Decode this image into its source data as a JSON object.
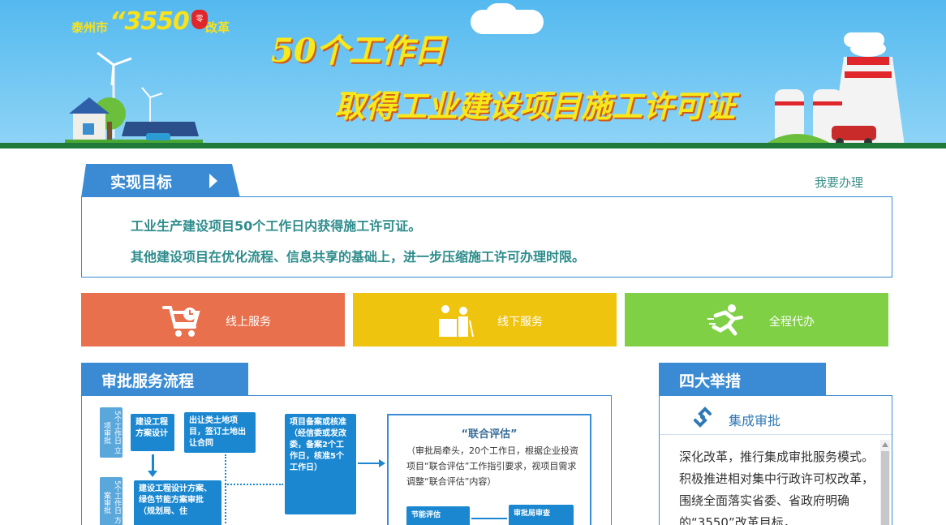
{
  "banner": {
    "logo_city": "泰州市",
    "logo_number": "“3550”",
    "logo_suffix": "改革",
    "logo_seal": "零",
    "headline_1": "50个工作日",
    "headline_2": "取得工业建设项目施工许可证"
  },
  "target": {
    "tab_label": "实现目标",
    "apply_link": "我要办理",
    "lines": [
      "工业生产建设项目50个工作日内获得施工许可证。",
      "其他建设项目在优化流程、信息共享的基础上，进一步压缩施工许可办理时限。"
    ]
  },
  "services": [
    {
      "label": "线上服务",
      "icon": "shopping-cart-icon",
      "color": "#e9704c"
    },
    {
      "label": "线下服务",
      "icon": "service-counter-icon",
      "color": "#eec40f"
    },
    {
      "label": "全程代办",
      "icon": "running-person-icon",
      "color": "#7fd044"
    }
  ],
  "flow": {
    "header": "审批服务流程",
    "stage_labels": [
      "5个工作日 立项审批",
      "5个工作日 方案审批"
    ],
    "boxes": {
      "design": "建设工程方案设计",
      "land": "出让类土地项目，签订土地出让合同",
      "scheme": "建设工程设计方案、绿色节能方案审批（规划局、住",
      "filing": "项目备案或核准（经信委或发改委，备案2个工作日，核准5个工作日）"
    },
    "evaluation": {
      "title": "“联合评估”",
      "text": "（审批局牵头，20个工作日，根据企业投资项目“联合评估”工作指引要求，视项目需求调整“联合评估”内容）",
      "sub_left": "节能评估",
      "sub_right": "审批局审查"
    }
  },
  "measures": {
    "header": "四大举措",
    "item_title": "集成审批",
    "item_icon": "link-icon",
    "body": "深化改革，推行集成审批服务模式。积极推进相对集中行政许可权改革，围绕全面落实省委、省政府明确的“3550”改革目标，"
  }
}
